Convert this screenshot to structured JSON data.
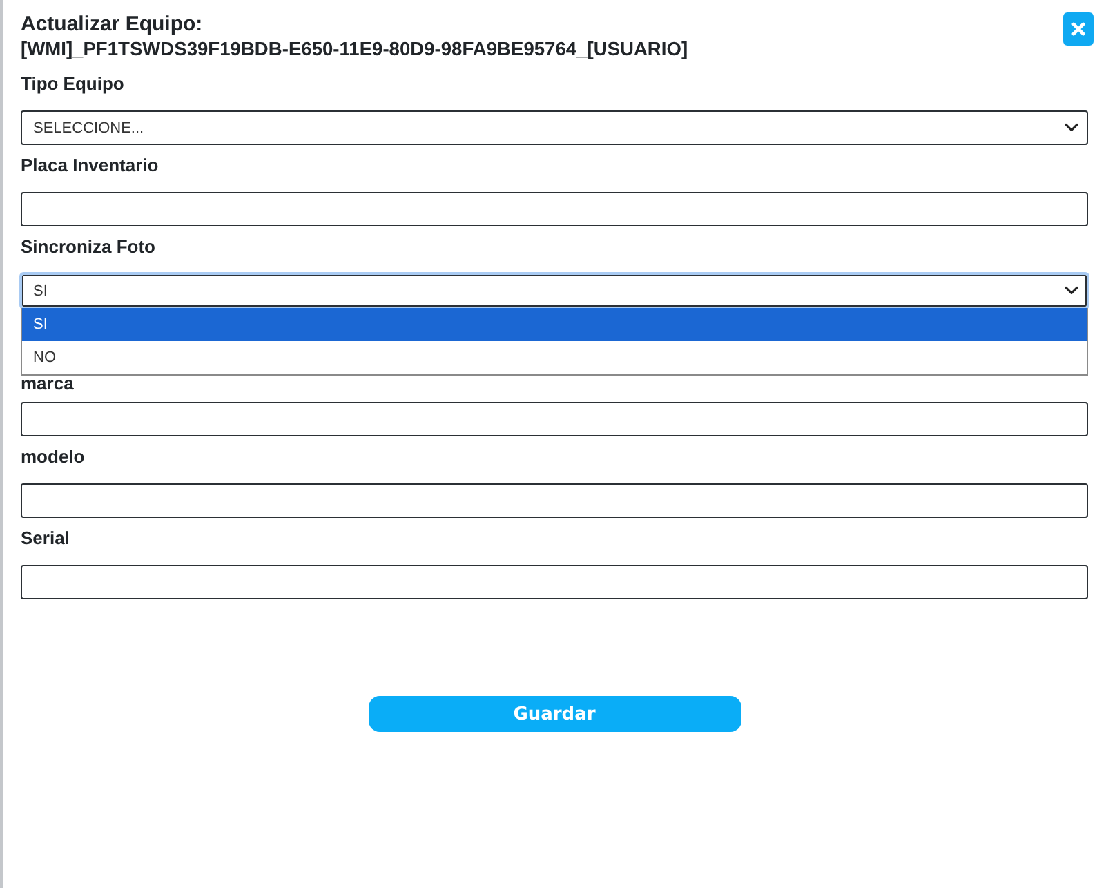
{
  "dialog": {
    "title": "Actualizar Equipo:",
    "subtitle": "[WMI]_PF1TSWDS39F19BDB-E650-11E9-80D9-98FA9BE95764_[USUARIO]"
  },
  "fields": [
    {
      "kind": "select",
      "label": "Tipo Equipo",
      "value": "SELECCIONE...",
      "focused": false,
      "expanded": false
    },
    {
      "kind": "text",
      "label": "Placa Inventario",
      "focused": false
    },
    {
      "kind": "select",
      "label": "Sincroniza Foto",
      "value": "SI",
      "focused": true,
      "expanded": true,
      "options": [
        {
          "label": "SI",
          "selected": true
        },
        {
          "label": "NO",
          "selected": false
        }
      ]
    },
    {
      "kind": "text",
      "label": "marca",
      "focused": false
    },
    {
      "kind": "text",
      "label": "modelo",
      "focused": false
    },
    {
      "kind": "text",
      "label": "Serial",
      "focused": false
    }
  ],
  "buttons": [
    {
      "label": "Guardar"
    }
  ]
}
